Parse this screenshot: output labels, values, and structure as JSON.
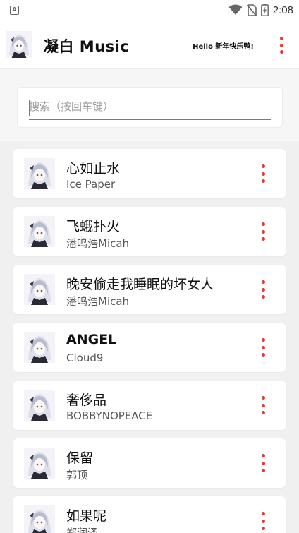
{
  "status_bar": {
    "time": "2:08",
    "notification_icon": "A"
  },
  "app": {
    "title": "凝白 Music",
    "greeting": "Hello  新年快乐鸭!",
    "avatar_icon": "anime-girl-avatar",
    "menu_icon": "more-vert"
  },
  "search": {
    "placeholder": "搜索（按回车键）",
    "value": ""
  },
  "accent": "#e0457b",
  "menu_color": "#e53935",
  "songs": [
    {
      "title": "心如止水",
      "artist": "Ice Paper"
    },
    {
      "title": "飞蛾扑火",
      "artist": "潘鸣浩Micah"
    },
    {
      "title": "晚安偷走我睡眠的坏女人",
      "artist": "潘鸣浩Micah"
    },
    {
      "title": "ANGEL",
      "artist": "Cloud9"
    },
    {
      "title": "奢侈品",
      "artist": "BOBBYNOPEACE"
    },
    {
      "title": "保留",
      "artist": "郭顶"
    },
    {
      "title": "如果呢",
      "artist": "郑润泽"
    }
  ]
}
